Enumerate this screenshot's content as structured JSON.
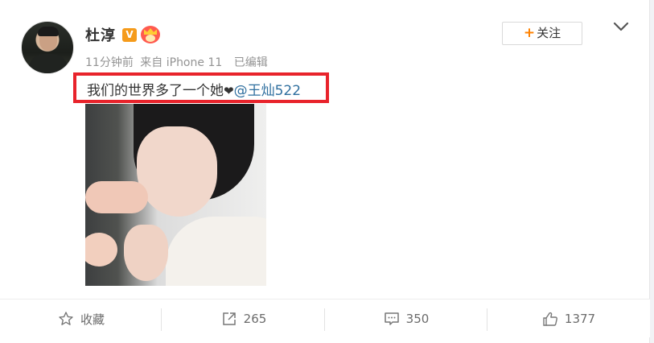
{
  "user": {
    "name": "杜淳",
    "badge_v": "V"
  },
  "meta": {
    "time": "11分钟前",
    "source": "来自 iPhone 11",
    "edited": "已编辑"
  },
  "follow_button": {
    "plus": "+",
    "label": "关注"
  },
  "post": {
    "text": "我们的世界多了一个她",
    "heart": "❤",
    "mention": "@王灿522"
  },
  "actions": {
    "favorite_label": "收藏",
    "repost_count": "265",
    "comment_count": "350",
    "like_count": "1377"
  },
  "colors": {
    "accent_orange": "#ff8200",
    "highlight_red": "#e8232b",
    "mention_blue": "#2f6f9f"
  }
}
